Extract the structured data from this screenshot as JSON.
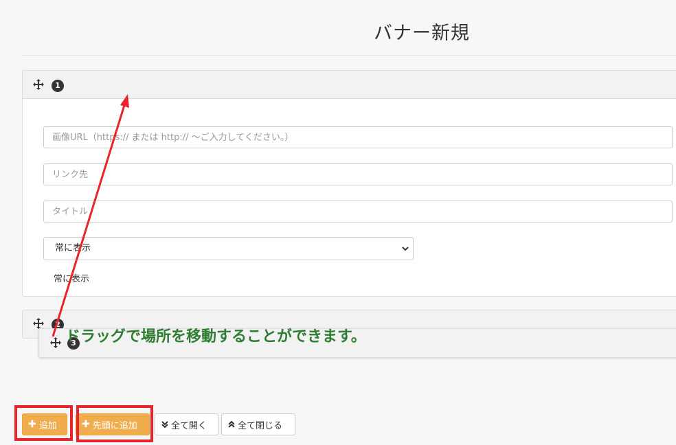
{
  "page": {
    "title": "バナー新規"
  },
  "panels": [
    {
      "number": "1",
      "fields": {
        "image_url_placeholder": "画像URL（https:// または http:// ～ご入力してください。）",
        "link_placeholder": "リンク先",
        "title_placeholder": "タイトル"
      },
      "display_select": {
        "selected": "常に表示"
      },
      "display_text": "常に表示"
    },
    {
      "number": "2"
    },
    {
      "number": "3"
    }
  ],
  "annotation": {
    "hint": "ドラッグで場所を移動することができます。",
    "highlight_color": "#e8252b",
    "hint_color": "#2e7d32"
  },
  "toolbar": {
    "add_label": "追加",
    "add_top_label": "先頭に追加",
    "expand_all_label": "全て開く",
    "collapse_all_label": "全て閉じる"
  },
  "colors": {
    "accent": "#f0ad4e",
    "badge": "#333333"
  },
  "icons": [
    "move-icon",
    "plus-icon",
    "chevron-double-down-icon",
    "chevron-double-up-icon",
    "chevron-down-icon"
  ]
}
